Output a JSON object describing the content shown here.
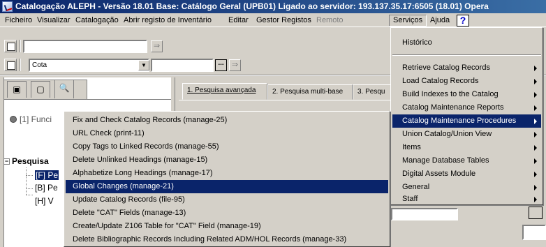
{
  "window": {
    "title": "Catalogação ALEPH - Versão 18.01  Base: Catálogo Geral (UPB01)  Ligado ao servidor: 193.137.35.17:6505 (18.01)  Opera"
  },
  "menubar": {
    "items": [
      "Ficheiro",
      "Visualizar",
      "Catalogação",
      "Abrir registo de Inventário",
      "Editar",
      "Gestor Registos",
      "Remoto",
      "Serviços",
      "Ajuda"
    ],
    "help_symbol": "?"
  },
  "toolbar": {
    "search_field_value": "",
    "code_dropdown_value": "Cota",
    "code_input_value": "",
    "dots_label": "...",
    "arrow_label": "⇒"
  },
  "left_panel": {
    "tabs": [
      "▣",
      "▢",
      "🔍"
    ],
    "function_label": "[1] Funci",
    "tree": {
      "root_label": "Pesquisa",
      "children": [
        "[F] Pe",
        "[B] Pe",
        "[H] V"
      ]
    }
  },
  "search_tabs": [
    "1. Pesquisa avançada",
    "2. Pesquisa multi-base",
    "3. Pesqu"
  ],
  "services_menu": {
    "items": [
      {
        "label": "Histórico",
        "submenu": false
      },
      {
        "label": "Retrieve Catalog Records",
        "submenu": true
      },
      {
        "label": "Load Catalog Records",
        "submenu": true
      },
      {
        "label": "Build Indexes to the Catalog",
        "submenu": true
      },
      {
        "label": "Catalog Maintenance Reports",
        "submenu": true
      },
      {
        "label": "Catalog Maintenance Procedures",
        "submenu": true
      },
      {
        "label": "Union Catalog/Union View",
        "submenu": true
      },
      {
        "label": "Items",
        "submenu": true
      },
      {
        "label": "Manage Database Tables",
        "submenu": true
      },
      {
        "label": "Digital Assets Module",
        "submenu": true
      },
      {
        "label": "General",
        "submenu": true
      },
      {
        "label": "Staff",
        "submenu": true
      }
    ],
    "highlighted": "Catalog Maintenance Procedures"
  },
  "procedures_submenu": {
    "items": [
      "Fix and Check Catalog Records (manage-25)",
      "URL Check (print-11)",
      "Copy Tags to Linked Records (manage-55)",
      "Delete Unlinked Headings (manage-15)",
      "Alphabetize Long Headings (manage-17)",
      "Global Changes (manage-21)",
      "Update Catalog Records (file-95)",
      "Delete \"CAT\" Fields (manage-13)",
      "Create/Update Z106 Table for \"CAT\" Field (manage-19)",
      "Delete Bibliographic Records Including Related ADM/HOL Records (manage-33)"
    ],
    "highlighted": "Global Changes (manage-21)"
  },
  "colors": {
    "menu_highlight": "#0a246a",
    "face": "#d4d0c8",
    "title_gradient_end": "#3a6ea5"
  }
}
